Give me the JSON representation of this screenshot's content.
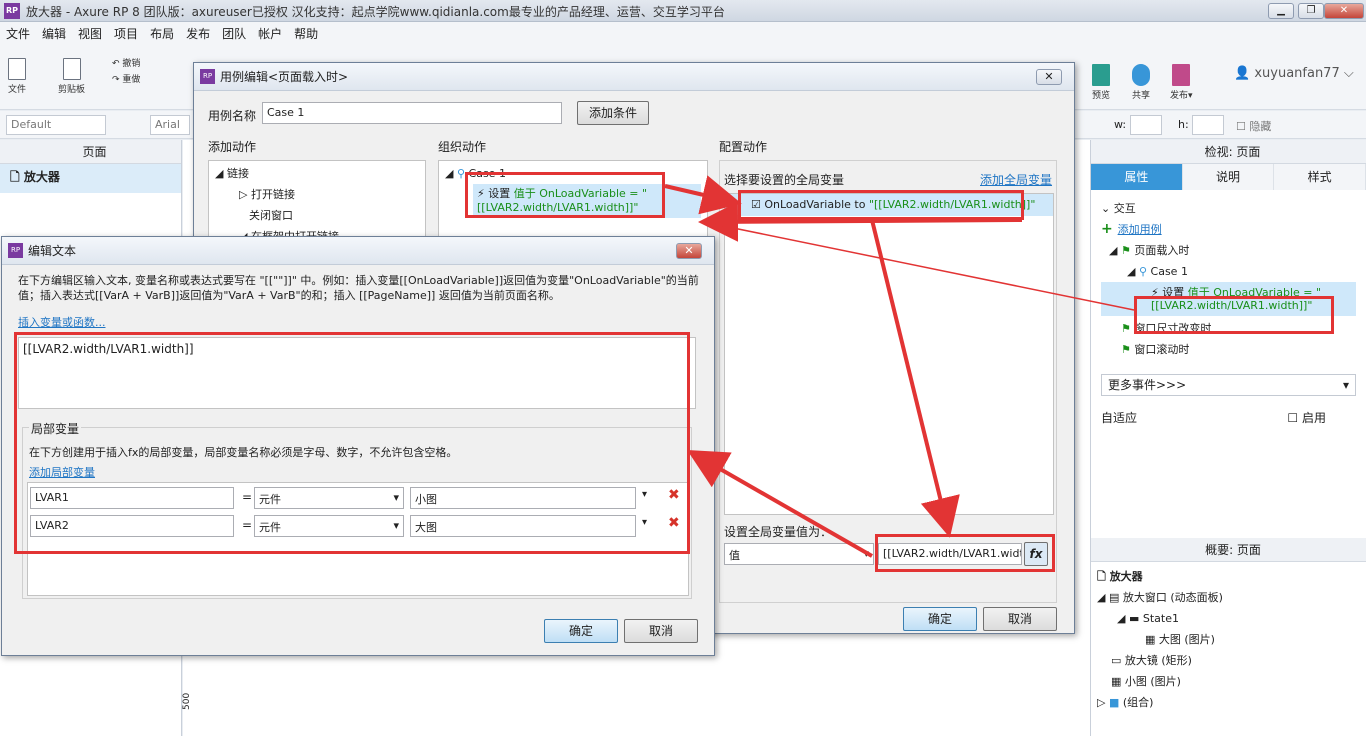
{
  "window": {
    "title": "放大器 - Axure RP 8 团队版：axureuser已授权 汉化支持：起点学院www.qidianla.com最专业的产品经理、运营、交互学习平台",
    "btn_min": "▁",
    "btn_max": "❐",
    "btn_close": "✕"
  },
  "menu": [
    "文件",
    "编辑",
    "视图",
    "项目",
    "布局",
    "发布",
    "团队",
    "帐户",
    "帮助"
  ],
  "toolbar": {
    "file": "文件",
    "clipboard": "剪贴板",
    "undo": "撤销",
    "redo": "重做",
    "preview": "预览",
    "share": "共享",
    "publish": "发布▾",
    "user": "xuyuanfan77"
  },
  "format": {
    "style": "Default",
    "font": "Arial",
    "w_label": "w:",
    "h_label": "h:",
    "hide": "隐藏"
  },
  "left_panel": {
    "title": "页面",
    "page": "放大器",
    "ruler": "500"
  },
  "right_panel": {
    "header": "检视: 页面",
    "tabs": [
      "属性",
      "说明",
      "样式"
    ],
    "section": "交互",
    "add_case": "添加用例",
    "event_load": "页面载入时",
    "case": "Case 1",
    "action_prefix": "设置",
    "action_text": "值于 OnLoadVariable = \"[[LVAR2.width/LVAR1.width]]\"",
    "event_resize": "窗口尺寸改变时",
    "event_scroll": "窗口滚动时",
    "more_events": "更多事件>>>",
    "adaptive": "自适应",
    "enable": "启用",
    "outline_header": "概要: 页面",
    "outline": [
      "放大器",
      "放大窗口 (动态面板)",
      "State1",
      "大图 (图片)",
      "放大镜 (矩形)",
      "小图 (图片)",
      "(组合)"
    ]
  },
  "case_dialog": {
    "title": "用例编辑<页面载入时>",
    "name_label": "用例名称",
    "name_value": "Case 1",
    "add_condition": "添加条件",
    "col1": "添加动作",
    "col2": "组织动作",
    "col3": "配置动作",
    "actions": [
      "链接",
      "打开链接",
      "关闭窗口",
      "在框架中打开链接"
    ],
    "org_case": "Case 1",
    "org_action_prefix": "设置",
    "org_action_text": "值于 OnLoadVariable = \"[[LVAR2.width/LVAR1.width]]\"",
    "select_global": "选择要设置的全局变量",
    "add_global": "添加全局变量",
    "var_item": "OnLoadVariable to ",
    "var_value": "\"[[LVAR2.width/LVAR1.width]]\"",
    "set_value_label": "设置全局变量值为：",
    "value_type": "值",
    "value_expr": "[[LVAR2.width/LVAR1.width]]",
    "fx": "fx",
    "ok": "确定",
    "cancel": "取消"
  },
  "edit_dialog": {
    "title": "编辑文本",
    "desc": "在下方编辑区输入文本, 变量名称或表达式要写在 \"[[\"\"]]\" 中。例如：插入变量[[OnLoadVariable]]返回值为变量\"OnLoadVariable\"的当前值；插入表达式[[VarA + VarB]]返回值为\"VarA + VarB\"的和；插入 [[PageName]] 返回值为当前页面名称。",
    "insert_link": "插入变量或函数...",
    "text": "[[LVAR2.width/LVAR1.width]]",
    "local_title": "局部变量",
    "local_desc": "在下方创建用于插入fx的局部变量，局部变量名称必须是字母、数字，不允许包含空格。",
    "add_local": "添加局部变量",
    "rows": [
      {
        "name": "LVAR1",
        "eq": "=",
        "type": "元件",
        "target": "小图"
      },
      {
        "name": "LVAR2",
        "eq": "=",
        "type": "元件",
        "target": "大图"
      }
    ],
    "ok": "确定",
    "cancel": "取消"
  },
  "colors": {
    "accent": "#3896d8",
    "annotation": "#e23434",
    "action_green": "#1a8f1a"
  }
}
